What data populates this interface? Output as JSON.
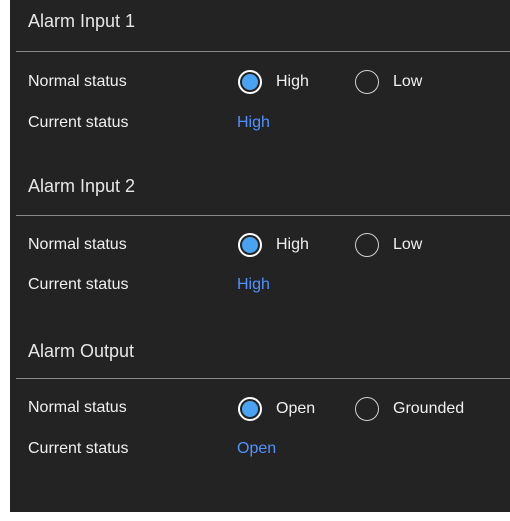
{
  "sections": [
    {
      "title": "Alarm Input 1",
      "normal_label": "Normal status",
      "current_label": "Current status",
      "options": [
        {
          "label": "High",
          "checked": true
        },
        {
          "label": "Low",
          "checked": false
        }
      ],
      "current_value": "High"
    },
    {
      "title": "Alarm Input 2",
      "normal_label": "Normal status",
      "current_label": "Current status",
      "options": [
        {
          "label": "High",
          "checked": true
        },
        {
          "label": "Low",
          "checked": false
        }
      ],
      "current_value": "High"
    },
    {
      "title": "Alarm Output",
      "normal_label": "Normal status",
      "current_label": "Current status",
      "options": [
        {
          "label": "Open",
          "checked": true
        },
        {
          "label": "Grounded",
          "checked": false
        }
      ],
      "current_value": "Open"
    }
  ],
  "colors": {
    "panel_background": "#232323",
    "radio_selected": "#4aa3f0",
    "current_value_text": "#4f92ff",
    "divider": "#8a8a8a"
  },
  "icons": {
    "radio_selected": "radio-checked-icon",
    "radio_unselected": "radio-unchecked-icon"
  }
}
